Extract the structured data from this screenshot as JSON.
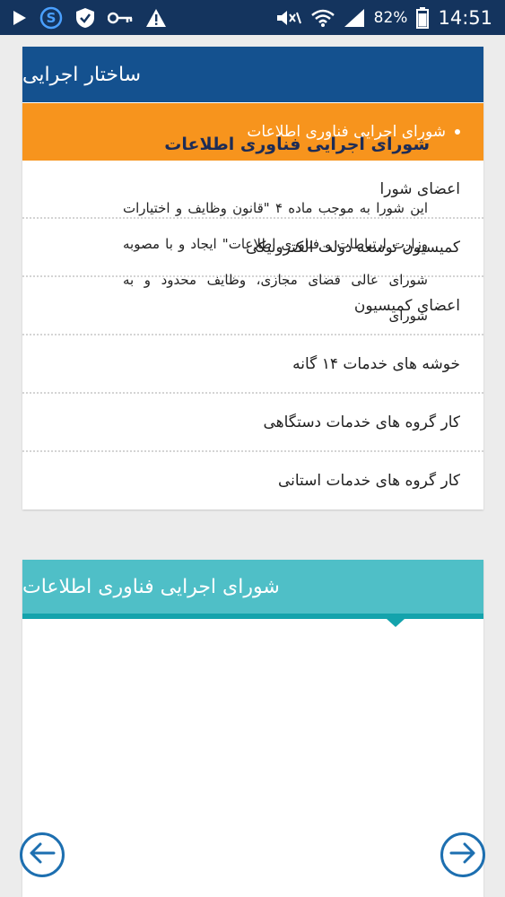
{
  "status_bar": {
    "battery_text": "82%",
    "time": "14:51",
    "left_icons": [
      "play-icon",
      "s-app-icon",
      "shield-icon",
      "key-icon",
      "warning-icon"
    ],
    "right_icons": [
      "mute-icon",
      "wifi-icon",
      "signal-icon",
      "battery-icon"
    ]
  },
  "structure_card": {
    "title": "ساختار اجرایی",
    "items": [
      {
        "label": "شورای اجرایی فناوری اطلاعات",
        "active": true
      },
      {
        "label": "اعضای شورا",
        "active": false
      },
      {
        "label": "کمیسیون توسعه دولت الکترونیکی",
        "active": false
      },
      {
        "label": "اعضای کمیسیون",
        "active": false
      },
      {
        "label": "خوشه های خدمات ۱۴ گانه",
        "active": false
      },
      {
        "label": "کار گروه های خدمات دستگاهی",
        "active": false
      },
      {
        "label": "کار گروه های خدمات استانی",
        "active": false
      }
    ]
  },
  "content_card": {
    "header": "شورای اجرایی فناوری اطلاعات",
    "article_title": "شورای اجرایی فناوری اطلاعات",
    "body": "این شورا به موجب ماده ۴ \"قانون وظایف و اختیارات وزارت ارتباطات و فناوری اطلاعات\" ایجاد و با مصوبه شورای عالی فضای مجازی، وظایف محدود و به شورای"
  },
  "colors": {
    "status_bar": "#14345e",
    "header_blue": "#14518f",
    "active_orange": "#f7941d",
    "teal_header": "#4fbfc7",
    "teal_border": "#14a3ac",
    "arrow_blue": "#1d6fb0"
  },
  "navigation": {
    "prev_icon": "arrow-left-circle-icon",
    "next_icon": "arrow-right-circle-icon"
  }
}
